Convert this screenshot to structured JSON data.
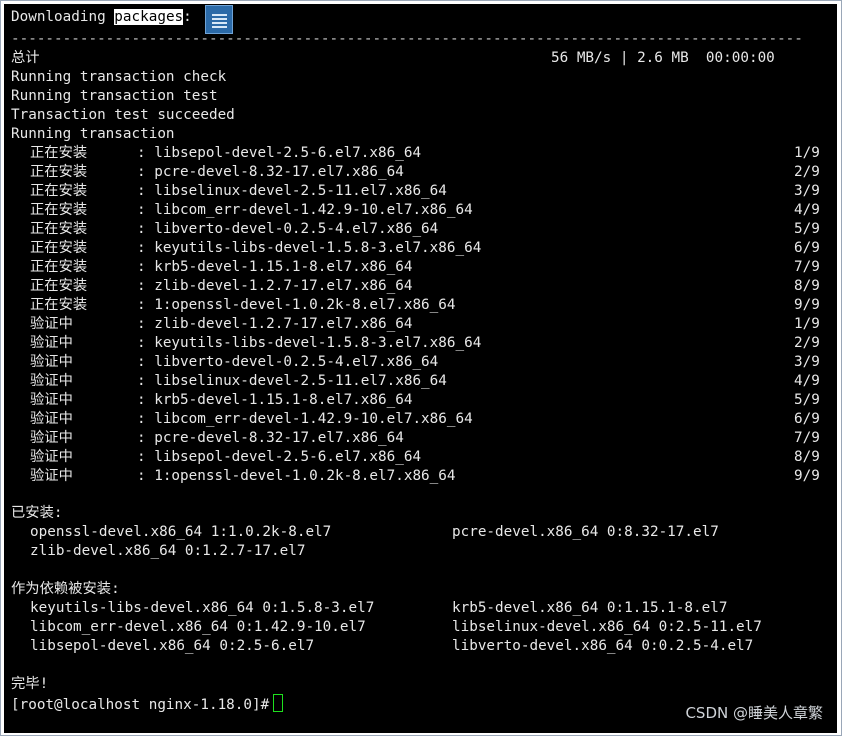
{
  "terminal": {
    "header_prefix": "Downloading ",
    "header_highlight": "packages",
    "header_suffix": ":",
    "separator": "--------------------------------------------------------------------------------------------",
    "total_label": "总计",
    "total_stats": "56 MB/s | 2.6 MB  00:00:00",
    "status_lines": [
      "Running transaction check",
      "Running transaction test",
      "Transaction test succeeded",
      "Running transaction"
    ],
    "install_rows": [
      {
        "action": "正在安装",
        "package": ": libsepol-devel-2.5-6.el7.x86_64",
        "count": "1/9"
      },
      {
        "action": "正在安装",
        "package": ": pcre-devel-8.32-17.el7.x86_64",
        "count": "2/9"
      },
      {
        "action": "正在安装",
        "package": ": libselinux-devel-2.5-11.el7.x86_64",
        "count": "3/9"
      },
      {
        "action": "正在安装",
        "package": ": libcom_err-devel-1.42.9-10.el7.x86_64",
        "count": "4/9"
      },
      {
        "action": "正在安装",
        "package": ": libverto-devel-0.2.5-4.el7.x86_64",
        "count": "5/9"
      },
      {
        "action": "正在安装",
        "package": ": keyutils-libs-devel-1.5.8-3.el7.x86_64",
        "count": "6/9"
      },
      {
        "action": "正在安装",
        "package": ": krb5-devel-1.15.1-8.el7.x86_64",
        "count": "7/9"
      },
      {
        "action": "正在安装",
        "package": ": zlib-devel-1.2.7-17.el7.x86_64",
        "count": "8/9"
      },
      {
        "action": "正在安装",
        "package": ": 1:openssl-devel-1.0.2k-8.el7.x86_64",
        "count": "9/9"
      }
    ],
    "verify_rows": [
      {
        "action": "验证中",
        "package": ": zlib-devel-1.2.7-17.el7.x86_64",
        "count": "1/9"
      },
      {
        "action": "验证中",
        "package": ": keyutils-libs-devel-1.5.8-3.el7.x86_64",
        "count": "2/9"
      },
      {
        "action": "验证中",
        "package": ": libverto-devel-0.2.5-4.el7.x86_64",
        "count": "3/9"
      },
      {
        "action": "验证中",
        "package": ": libselinux-devel-2.5-11.el7.x86_64",
        "count": "4/9"
      },
      {
        "action": "验证中",
        "package": ": krb5-devel-1.15.1-8.el7.x86_64",
        "count": "5/9"
      },
      {
        "action": "验证中",
        "package": ": libcom_err-devel-1.42.9-10.el7.x86_64",
        "count": "6/9"
      },
      {
        "action": "验证中",
        "package": ": pcre-devel-8.32-17.el7.x86_64",
        "count": "7/9"
      },
      {
        "action": "验证中",
        "package": ": libsepol-devel-2.5-6.el7.x86_64",
        "count": "8/9"
      },
      {
        "action": "验证中",
        "package": ": 1:openssl-devel-1.0.2k-8.el7.x86_64",
        "count": "9/9"
      }
    ],
    "installed_label": "已安装:",
    "installed_rows": [
      [
        "openssl-devel.x86_64 1:1.0.2k-8.el7",
        "pcre-devel.x86_64 0:8.32-17.el7"
      ],
      [
        "zlib-devel.x86_64 0:1.2.7-17.el7",
        ""
      ]
    ],
    "deps_label": "作为依赖被安装:",
    "deps_rows": [
      [
        "keyutils-libs-devel.x86_64 0:1.5.8-3.el7",
        "krb5-devel.x86_64 0:1.15.1-8.el7"
      ],
      [
        "libcom_err-devel.x86_64 0:1.42.9-10.el7",
        "libselinux-devel.x86_64 0:2.5-11.el7"
      ],
      [
        "libsepol-devel.x86_64 0:2.5-6.el7",
        "libverto-devel.x86_64 0:0.2.5-4.el7"
      ]
    ],
    "complete_label": "完毕!",
    "prompt": "[root@localhost nginx-1.18.0]#"
  },
  "watermark": "CSDN @睡美人章繁",
  "icons": {
    "package_icon": "document-lines-icon",
    "cursor": "block-cursor"
  },
  "colors": {
    "background": "#000000",
    "text": "#e8e8e8",
    "cursor": "#1ee01e",
    "icon": "#2b6aa8"
  }
}
